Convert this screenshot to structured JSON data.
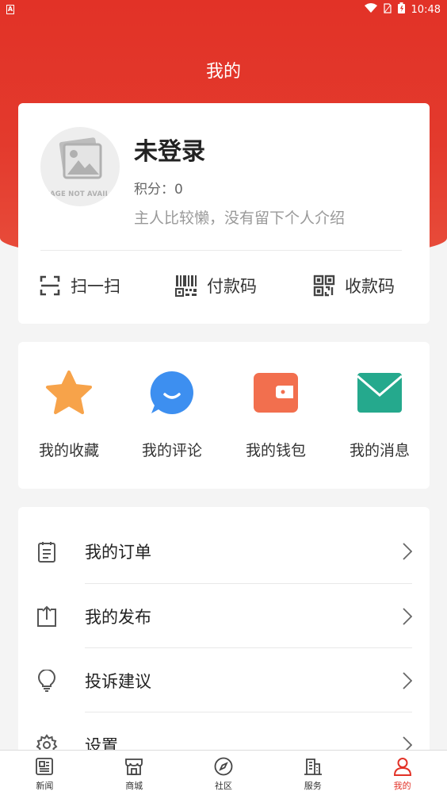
{
  "status_bar": {
    "left_icon": "A",
    "time": "10:48"
  },
  "header": {
    "title": "我的"
  },
  "profile": {
    "avatar_placeholder": "IMAGE NOT AVAILABLE",
    "name": "未登录",
    "points_label": "积分：",
    "points_value": "0",
    "bio": "主人比较懒，没有留下个人介绍"
  },
  "quick_actions": [
    {
      "icon": "scan-icon",
      "label": "扫一扫"
    },
    {
      "icon": "barcode-icon",
      "label": "付款码"
    },
    {
      "icon": "qrcode-icon",
      "label": "收款码"
    }
  ],
  "features": [
    {
      "icon": "star-icon",
      "label": "我的收藏",
      "color": "#f7a34a"
    },
    {
      "icon": "comment-icon",
      "label": "我的评论",
      "color": "#3d8ff0"
    },
    {
      "icon": "wallet-icon",
      "label": "我的钱包",
      "color": "#f26f4e"
    },
    {
      "icon": "mail-icon",
      "label": "我的消息",
      "color": "#25a98d"
    }
  ],
  "menu": [
    {
      "icon": "clipboard-icon",
      "label": "我的订单"
    },
    {
      "icon": "upload-icon",
      "label": "我的发布"
    },
    {
      "icon": "lightbulb-icon",
      "label": "投诉建议"
    },
    {
      "icon": "settings-icon",
      "label": "设置"
    }
  ],
  "bottom_nav": [
    {
      "icon": "news-icon",
      "label": "新闻"
    },
    {
      "icon": "store-icon",
      "label": "商城"
    },
    {
      "icon": "compass-icon",
      "label": "社区"
    },
    {
      "icon": "building-icon",
      "label": "服务"
    },
    {
      "icon": "user-icon",
      "label": "我的",
      "active": true
    }
  ],
  "colors": {
    "primary": "#e23227",
    "background": "#f4f4f4"
  }
}
